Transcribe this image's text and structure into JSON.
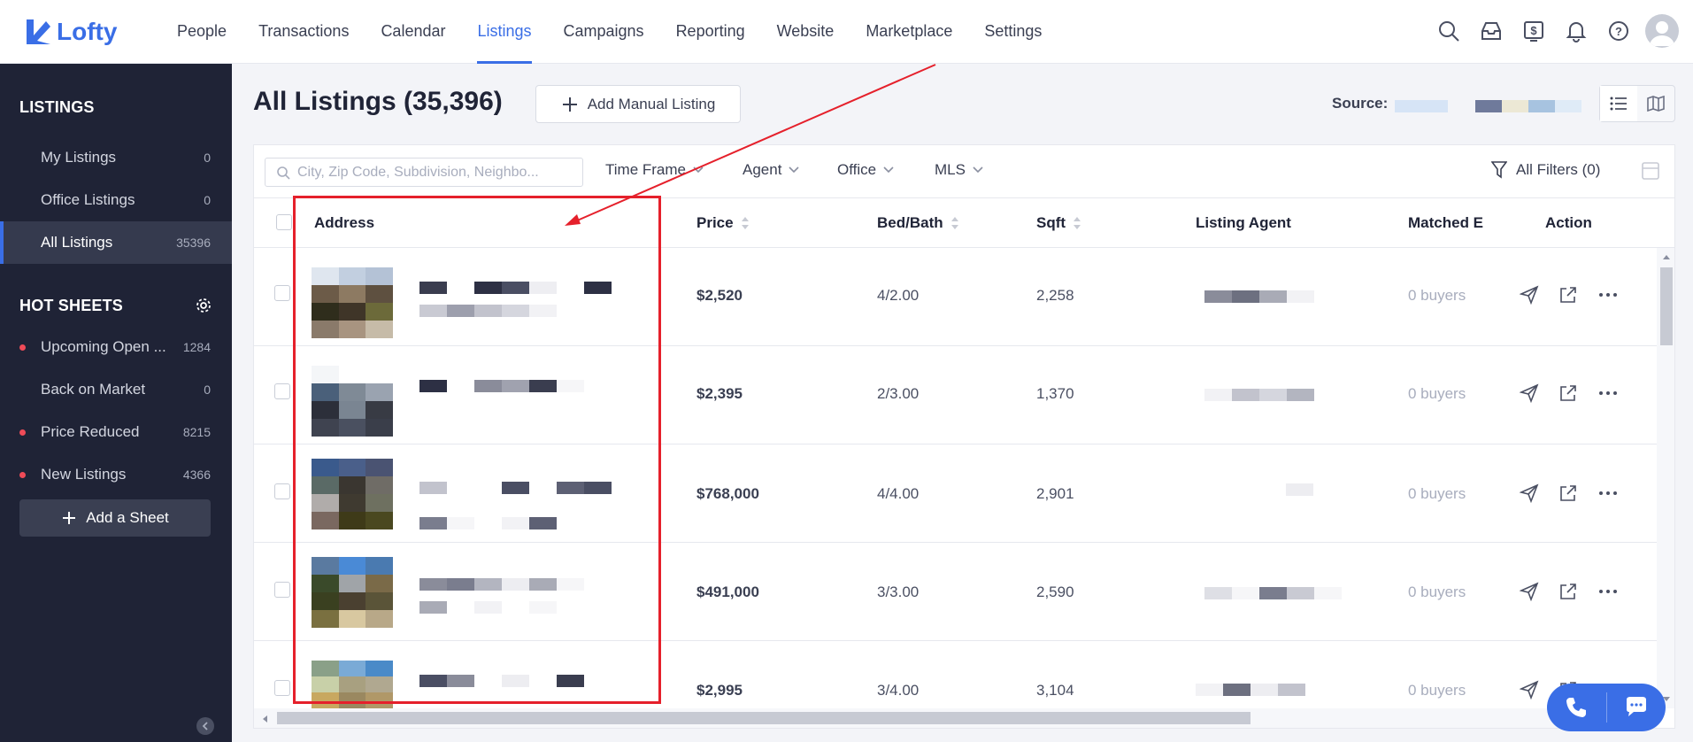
{
  "app": {
    "brand": "Lofty"
  },
  "nav": {
    "items": [
      {
        "label": "People"
      },
      {
        "label": "Transactions"
      },
      {
        "label": "Calendar"
      },
      {
        "label": "Listings",
        "active": true
      },
      {
        "label": "Campaigns"
      },
      {
        "label": "Reporting"
      },
      {
        "label": "Website"
      },
      {
        "label": "Marketplace"
      },
      {
        "label": "Settings"
      }
    ]
  },
  "sidebar": {
    "listings_title": "LISTINGS",
    "listings": [
      {
        "label": "My Listings",
        "count": "0"
      },
      {
        "label": "Office Listings",
        "count": "0"
      },
      {
        "label": "All Listings",
        "count": "35396",
        "active": true
      }
    ],
    "hotsheets_title": "HOT SHEETS",
    "hotsheets": [
      {
        "label": "Upcoming Open ...",
        "count": "1284",
        "dot": true
      },
      {
        "label": "Back on Market",
        "count": "0",
        "dot": false
      },
      {
        "label": "Price Reduced",
        "count": "8215",
        "dot": true
      },
      {
        "label": "New Listings",
        "count": "4366",
        "dot": true
      }
    ],
    "add_sheet_label": "Add a Sheet"
  },
  "main": {
    "title": "All Listings (35,396)",
    "add_manual_label": "Add Manual Listing",
    "source_label": "Source:"
  },
  "filters": {
    "search_placeholder": "City, Zip Code, Subdivision, Neighbo...",
    "time_frame": "Time Frame",
    "agent": "Agent",
    "office": "Office",
    "mls": "MLS",
    "all_filters": "All Filters (0)"
  },
  "table": {
    "columns": {
      "address": "Address",
      "price": "Price",
      "bedbath": "Bed/Bath",
      "sqft": "Sqft",
      "listing_agent": "Listing Agent",
      "matched": "Matched E",
      "action": "Action"
    },
    "rows": [
      {
        "price": "$2,520",
        "bedbath": "4/2.00",
        "sqft": "2,258",
        "matched": "0 buyers"
      },
      {
        "price": "$2,395",
        "bedbath": "2/3.00",
        "sqft": "1,370",
        "matched": "0 buyers"
      },
      {
        "price": "$768,000",
        "bedbath": "4/4.00",
        "sqft": "2,901",
        "matched": "0 buyers"
      },
      {
        "price": "$491,000",
        "bedbath": "3/3.00",
        "sqft": "2,590",
        "matched": "0 buyers"
      },
      {
        "price": "$2,995",
        "bedbath": "3/4.00",
        "sqft": "3,104",
        "matched": "0 buyers"
      }
    ]
  },
  "colors": {
    "accent": "#3a6ee6",
    "sidebar_bg": "#1f2336",
    "highlight": "#e5202b"
  },
  "icons": [
    "search-icon",
    "inbox-icon",
    "dollar-icon",
    "bell-icon",
    "help-icon",
    "avatar",
    "gear-icon",
    "list-view-icon",
    "map-view-icon",
    "filter-icon",
    "save-icon",
    "send-icon",
    "share-icon",
    "more-icon",
    "phone-icon",
    "chat-icon"
  ]
}
